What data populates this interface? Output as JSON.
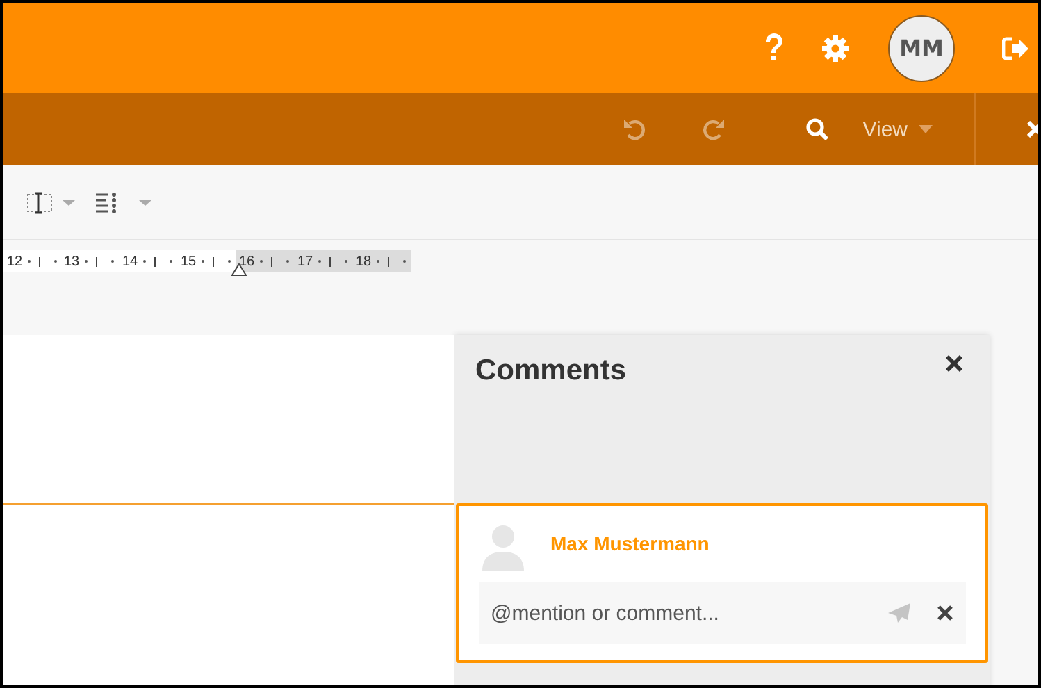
{
  "header": {
    "avatar_initials": "MM"
  },
  "toolbar": {
    "undo_disabled": true,
    "redo_disabled": true,
    "view_label": "View"
  },
  "ruler": [
    {
      "label": "12",
      "in_margin": false
    },
    {
      "label": "13",
      "in_margin": false
    },
    {
      "label": "14",
      "in_margin": false
    },
    {
      "label": "15",
      "in_margin": false
    },
    {
      "label": "16",
      "in_margin": true
    },
    {
      "label": "17",
      "in_margin": true
    },
    {
      "label": "18",
      "in_margin": true
    }
  ],
  "comments": {
    "title": "Comments",
    "author": "Max Mustermann",
    "placeholder": "@mention or comment..."
  }
}
